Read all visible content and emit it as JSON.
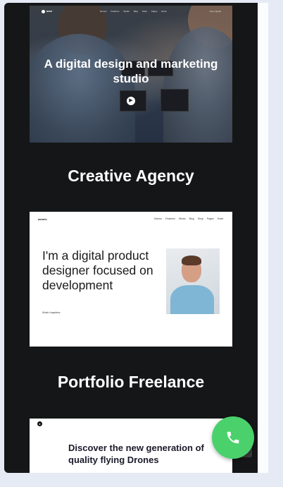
{
  "demos": [
    {
      "name": "Creative Agency",
      "preview": {
        "logo": "axon",
        "nav_links": [
          "Demos",
          "Features",
          "Works",
          "Blog",
          "Shop",
          "Pages",
          "Extra"
        ],
        "cta": "Get a Quote",
        "hero_title": "A digital design and marketing studio"
      }
    },
    {
      "name": "Portfolio Freelance",
      "preview": {
        "logo": "axonic",
        "nav_links": [
          "Demos",
          "Features",
          "Works",
          "Blog",
          "Shop",
          "Pages",
          "Extra"
        ],
        "heading": "I'm a digital product designer focused on development",
        "small_text": "Work Inquiries"
      }
    },
    {
      "name": "",
      "preview": {
        "heading": "Discover the new generation of quality flying Drones"
      }
    }
  ],
  "fab": {
    "icon": "phone-icon",
    "color": "#4bd16c"
  }
}
